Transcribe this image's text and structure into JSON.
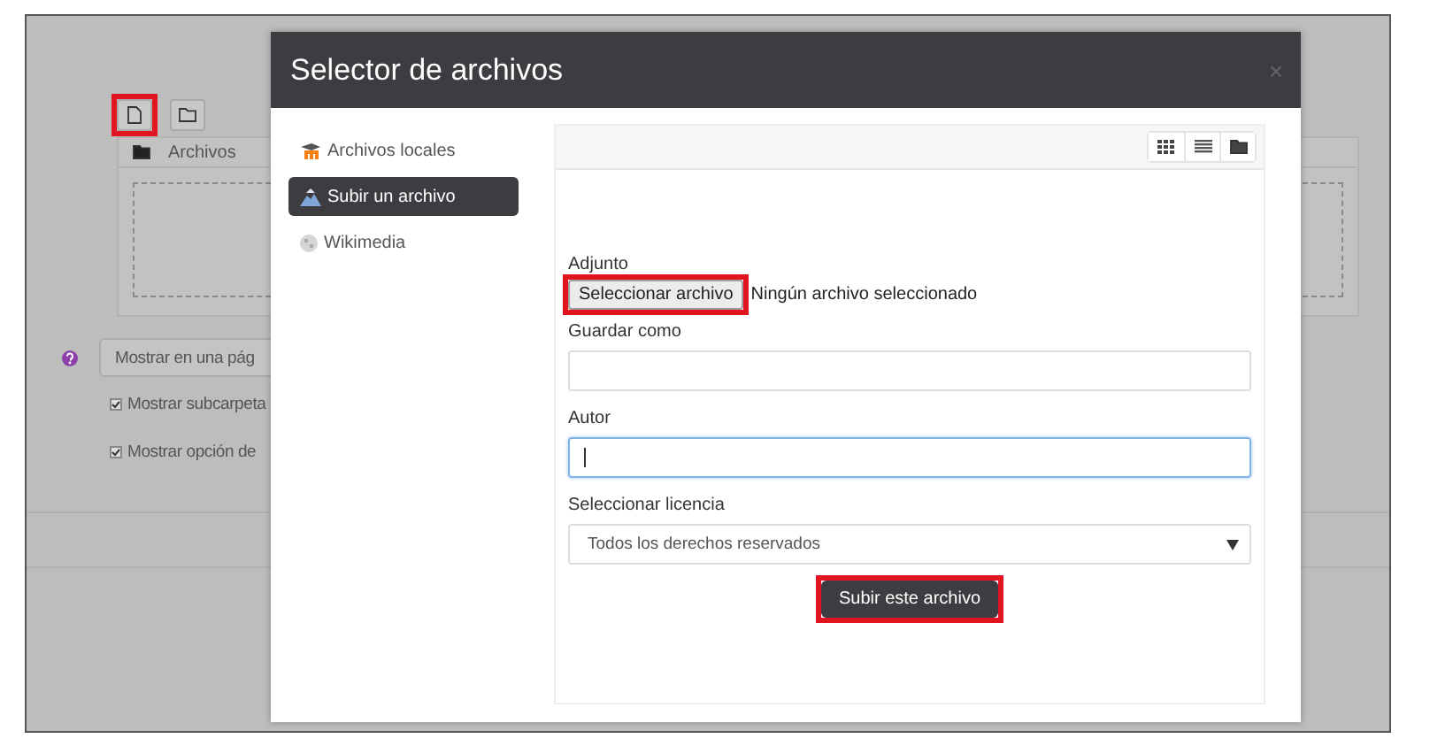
{
  "background": {
    "toolbar": [
      {
        "kind": "file",
        "highlighted": true
      },
      {
        "kind": "folder",
        "highlighted": false
      }
    ],
    "files_label": "Archivos",
    "display_select": "Mostrar en una pág",
    "checkboxes": [
      {
        "label": "Mostrar subcarpeta",
        "checked": true
      },
      {
        "label": "Mostrar opción de",
        "checked": true
      }
    ]
  },
  "modal": {
    "title": "Selector de archivos",
    "close": "×",
    "nav": [
      {
        "kind": "local",
        "label": "Archivos locales",
        "selected": false
      },
      {
        "kind": "upload",
        "label": "Subir un archivo",
        "selected": true
      },
      {
        "kind": "wikimedia",
        "label": "Wikimedia",
        "selected": false
      }
    ],
    "form": {
      "attachment_label": "Adjunto",
      "file_button": {
        "label": "Seleccionar archivo",
        "highlighted": true
      },
      "file_status": "Ningún archivo seleccionado",
      "save_as_label": "Guardar como",
      "author_label": "Autor",
      "author_focused": true,
      "license_label": "Seleccionar licencia",
      "license_value": "Todos los derechos reservados",
      "submit": {
        "label": "Subir este archivo",
        "highlighted": true
      }
    }
  }
}
